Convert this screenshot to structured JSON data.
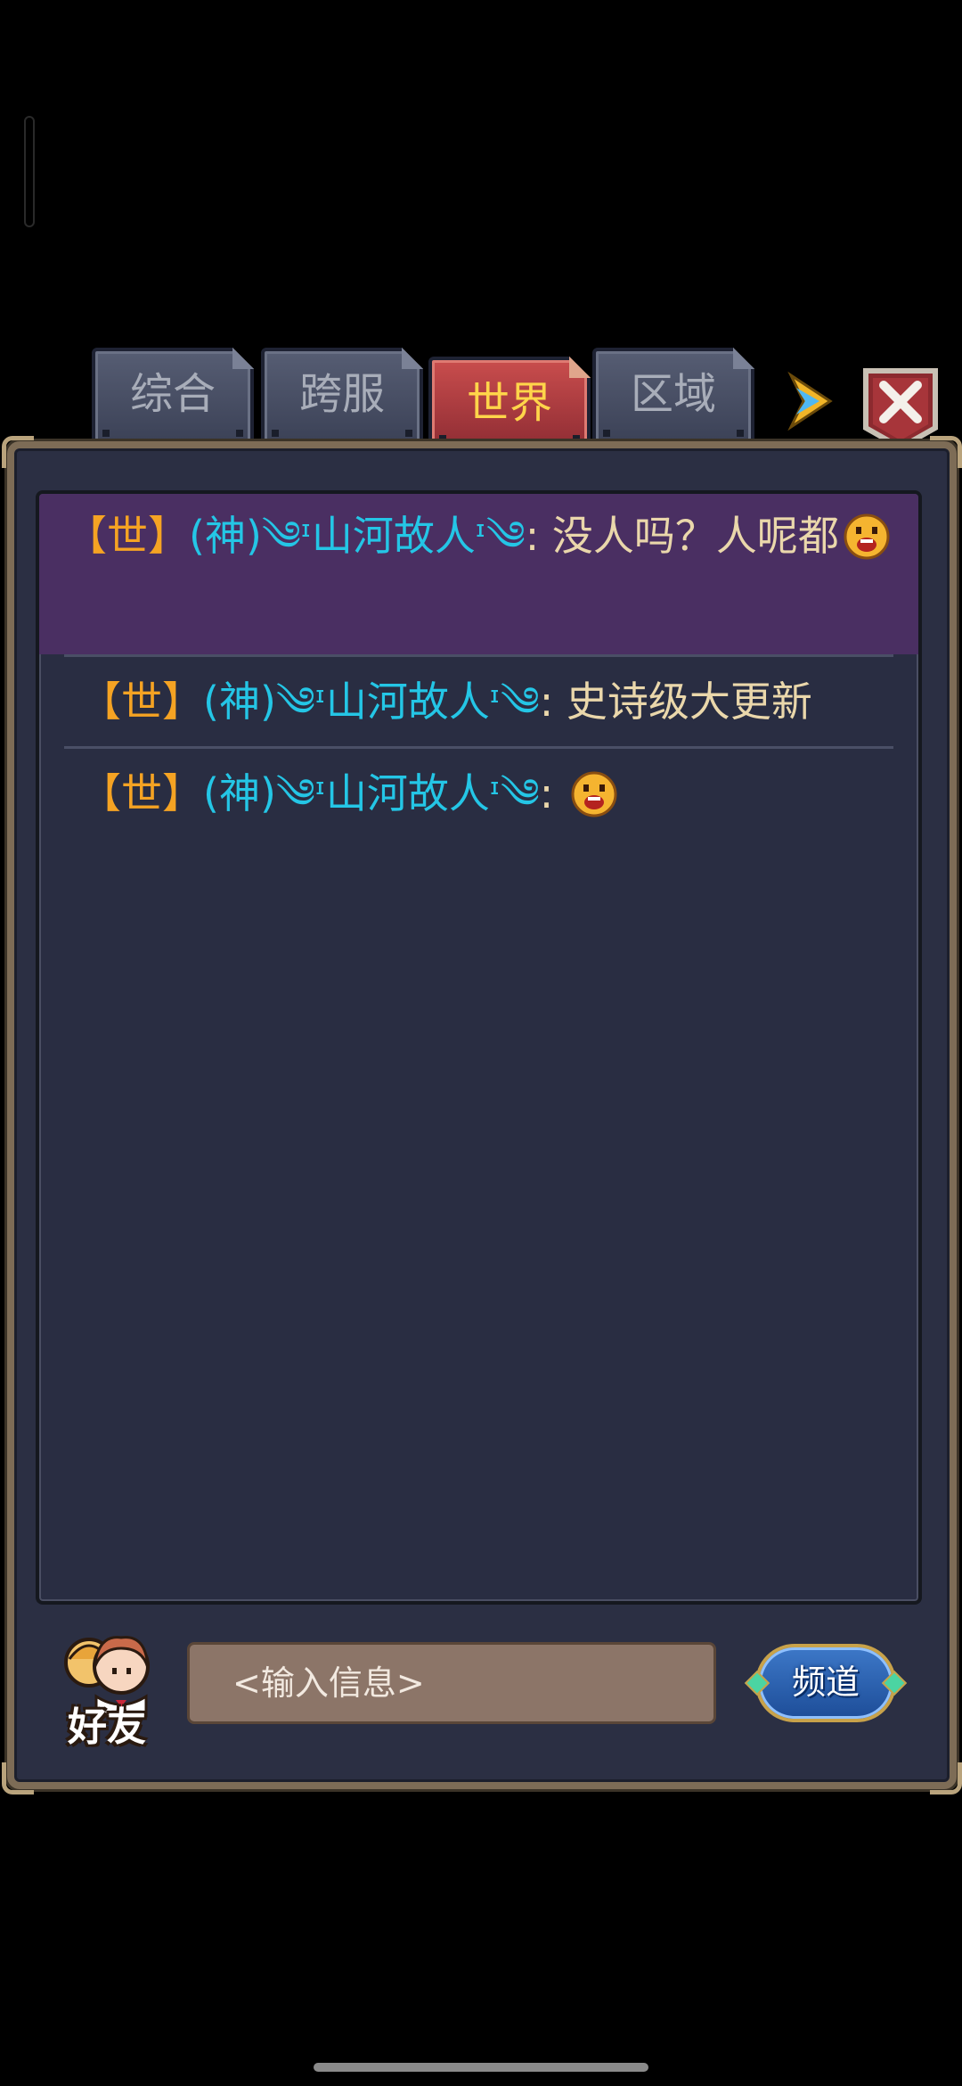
{
  "tabs": [
    {
      "label": "综合"
    },
    {
      "label": "跨服"
    },
    {
      "label": "世界"
    },
    {
      "label": "区域"
    }
  ],
  "active_tab": "世界",
  "messages": [
    {
      "channel": "【世】",
      "sender": "(神)༄ᶦ山河故人ᶦ༄",
      "separator": ":",
      "text": "没人吗？人呢都",
      "emoji": "smiley-face-emoji"
    },
    {
      "channel": "【世】",
      "sender": "(神)༄ᶦ山河故人ᶦ༄",
      "separator": ":",
      "text": "史诗级大更新"
    },
    {
      "channel": "【世】",
      "sender": "(神)༄ᶦ山河故人ᶦ༄",
      "separator": ":",
      "text": "",
      "emoji": "smiley-face-emoji"
    }
  ],
  "bottom": {
    "friends_label": "好友",
    "input_placeholder": "<输入信息>",
    "channel_label": "频道"
  },
  "icons": {
    "expand": "arrow-right-icon",
    "close": "close-icon",
    "friends": "friends-avatar-icon"
  },
  "colors": {
    "channel": "#f5a323",
    "sender": "#24c6e6",
    "text": "#ead7ab",
    "active_tab": "#c94d4d",
    "highlight_row": "#4a2f62"
  }
}
